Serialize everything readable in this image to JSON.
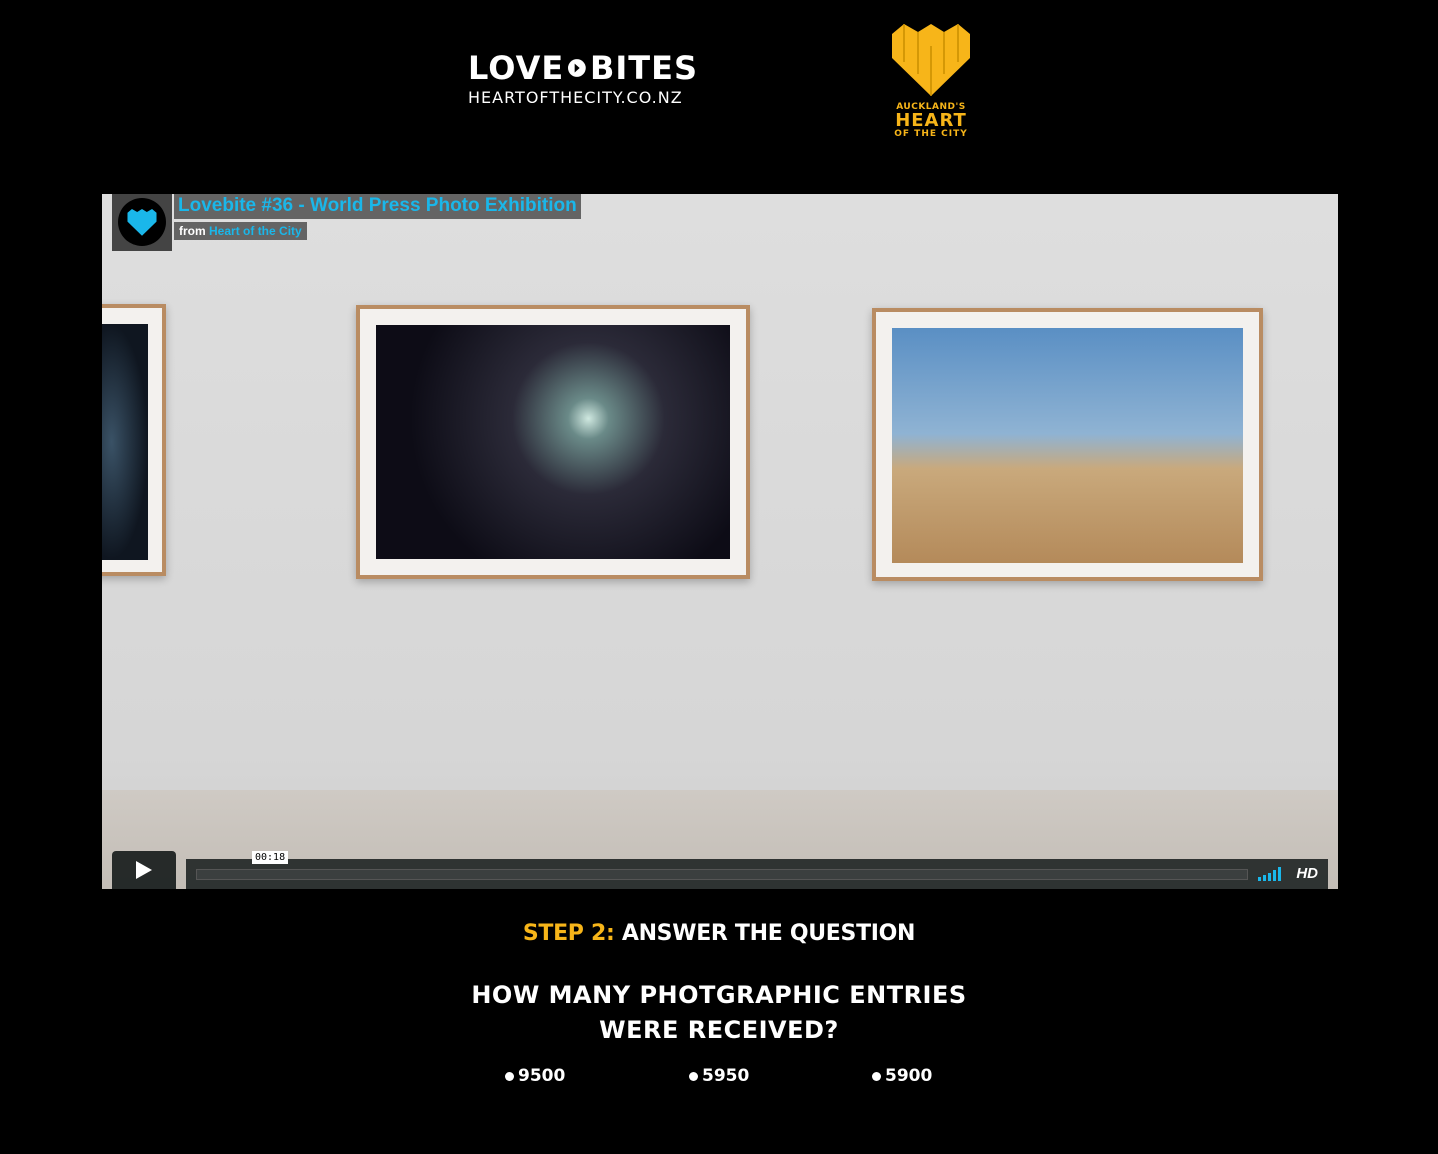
{
  "header": {
    "lovebites_left": "LOVE",
    "lovebites_right": "BITES",
    "lovebites_url": "HEARTOFTHECITY.CO.NZ",
    "hoc_line1": "AUCKLAND'S",
    "hoc_line2": "HEART",
    "hoc_line3": "OF THE CITY"
  },
  "video": {
    "title": "Lovebite #36 - World Press Photo Exhibition",
    "from_label": "from",
    "author": "Heart of the City",
    "timecode": "00:18",
    "hd_label": "HD"
  },
  "quiz": {
    "step_label": "STEP 2:",
    "step_text": " ANSWER THE QUESTION",
    "question_line1": "HOW MANY PHOTGRAPHIC ENTRIES",
    "question_line2": "WERE RECEIVED?",
    "answers": [
      "9500",
      "5950",
      "5900"
    ]
  },
  "colors": {
    "accent_orange": "#f7b519",
    "vimeo_blue": "#1ab7ea"
  }
}
